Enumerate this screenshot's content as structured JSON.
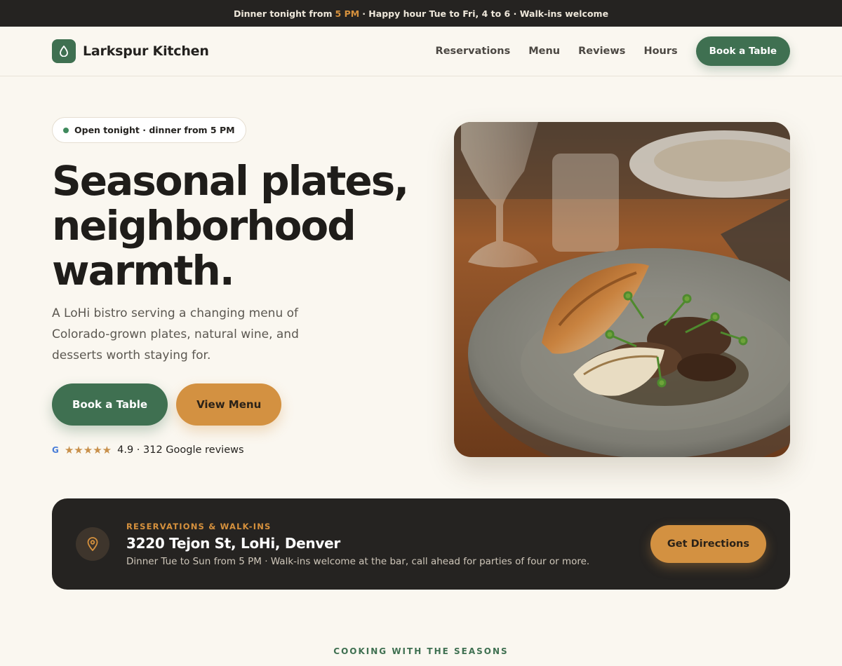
{
  "announcement": {
    "prefix": "Dinner tonight from",
    "accent": "5 PM",
    "suffix": "· Happy hour Tue to Fri, 4 to 6 · Walk-ins welcome"
  },
  "brand": {
    "name": "Larkspur Kitchen",
    "icon": "drop-icon"
  },
  "nav": {
    "links": [
      "Reservations",
      "Menu",
      "Reviews",
      "Hours"
    ],
    "cta": "Book a Table"
  },
  "hero": {
    "status": "Open tonight · dinner from 5 PM",
    "title_lines": [
      "Seasonal plates,",
      "neighborhood",
      "warmth."
    ],
    "text": "A LoHi bistro serving a changing menu of Colorado-grown plates, natural wine, and desserts worth staying for.",
    "primary_cta": "Book a Table",
    "secondary_cta": "View Menu",
    "rating": {
      "source_icon": "G",
      "stars": "★★★★★",
      "text": "4.9 · 312 Google reviews"
    },
    "image_alt": "plated roast chicken with mushrooms and greens"
  },
  "info": {
    "eyebrow": "RESERVATIONS & WALK-INS",
    "title": "3220 Tejon St, LoHi, Denver",
    "subtitle": "Dinner Tue to Sun from 5 PM · Walk-ins welcome at the bar, call ahead for parties of four or more.",
    "cta": "Get Directions"
  },
  "next_section": {
    "eyebrow": "COOKING WITH THE SEASONS"
  },
  "colors": {
    "green": "#3f7051",
    "amber": "#d39141",
    "dark": "#252321",
    "cream": "#faf7f0"
  }
}
